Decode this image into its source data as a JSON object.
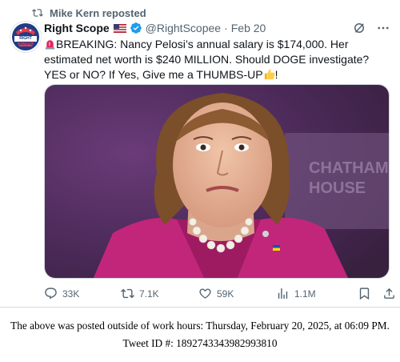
{
  "repost": {
    "label": "Mike Kern reposted",
    "icon": "repost-icon"
  },
  "author": {
    "display_name": "Right Scope",
    "flag_icon": "us-flag-icon",
    "verified_icon": "verified-badge-icon",
    "handle": "@RightScopee",
    "separator": "·",
    "date": "Feb 20",
    "avatar_text": "RIGHT SCOPE"
  },
  "tweet": {
    "siren_icon": "siren-icon",
    "text_main": "BREAKING: Nancy Pelosi’s annual salary is $174,000. Her estimated net worth is $240 MILLION. Should DOGE investigate? YES or NO? If Yes, Give me a THUMBS-UP",
    "thumbs_icon": "thumbs-up-icon",
    "text_end": "!"
  },
  "media": {
    "alt_icon": "photo"
  },
  "actions": {
    "replies": "33K",
    "reposts": "7.1K",
    "likes": "59K",
    "views": "1.1M"
  },
  "footer": {
    "line1": "The above was posted outside of work hours: Thursday, February 20, 2025, at 06:09 PM.",
    "line2": "Tweet ID #: 1892743343982993810"
  },
  "colors": {
    "accent": "#1d9bf0",
    "muted": "#536471",
    "magenta_jacket": "#c2267a"
  }
}
